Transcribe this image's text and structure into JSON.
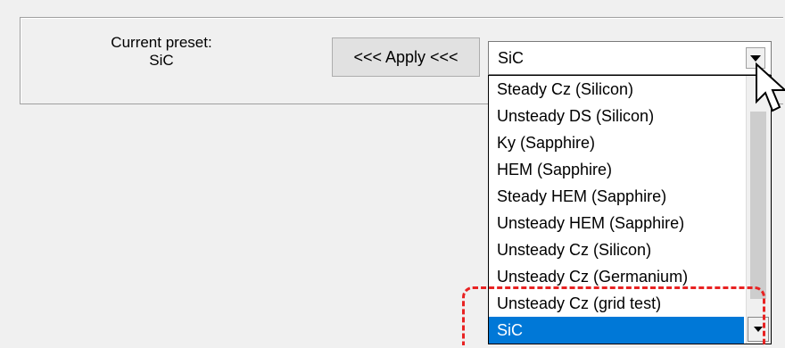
{
  "preset": {
    "label_line1": "Current preset:",
    "label_line2": "SiC"
  },
  "apply_button": {
    "label": "<<< Apply <<<"
  },
  "combo": {
    "value": "SiC"
  },
  "dropdown": {
    "items": [
      "Steady Cz (Silicon)",
      "Unsteady DS (Silicon)",
      "Ky (Sapphire)",
      "HEM (Sapphire)",
      "Steady HEM (Sapphire)",
      "Unsteady HEM (Sapphire)",
      "Unsteady Cz (Silicon)",
      "Unsteady Cz (Germanium)",
      "Unsteady Cz (grid test)",
      "SiC"
    ],
    "selected": "SiC"
  },
  "colors": {
    "selection": "#0078d7",
    "highlight": "#e82222"
  },
  "icons": {
    "combo_arrow": "chevron-down-icon",
    "cursor": "mouse-pointer-icon"
  }
}
